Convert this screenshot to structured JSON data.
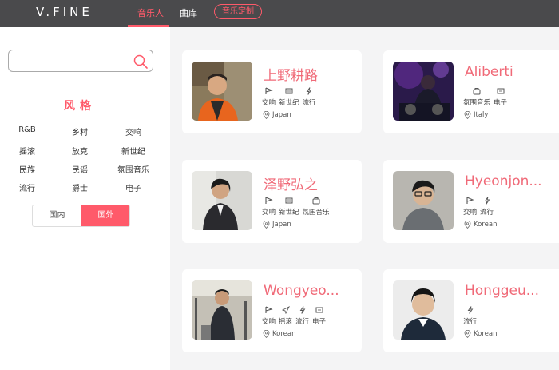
{
  "header": {
    "logo": "V.FINE",
    "nav": [
      {
        "label": "音乐人",
        "active": true
      },
      {
        "label": "曲库",
        "active": false
      },
      {
        "label": "音乐定制",
        "active": false
      }
    ]
  },
  "sidebar": {
    "search": {
      "value": "",
      "placeholder": ""
    },
    "style_title": "风格",
    "genres": [
      "R&B",
      "乡村",
      "交响",
      "摇滚",
      "放克",
      "新世纪",
      "民族",
      "民谣",
      "氛围音乐",
      "流行",
      "爵士",
      "电子"
    ],
    "region": {
      "domestic": "国内",
      "foreign": "国外",
      "selected": "国外"
    }
  },
  "artists": [
    {
      "name": "上野耕路",
      "tags": [
        {
          "icon": "symphony-icon",
          "label": "交响"
        },
        {
          "icon": "new-age-icon",
          "label": "新世纪"
        },
        {
          "icon": "pop-icon",
          "label": "流行"
        }
      ],
      "location": "Japan"
    },
    {
      "name": "Aliberti",
      "tags": [
        {
          "icon": "ambient-icon",
          "label": "氛围音乐"
        },
        {
          "icon": "electronic-icon",
          "label": "电子"
        }
      ],
      "location": "Italy"
    },
    {
      "name": "泽野弘之",
      "tags": [
        {
          "icon": "symphony-icon",
          "label": "交响"
        },
        {
          "icon": "new-age-icon",
          "label": "新世纪"
        },
        {
          "icon": "ambient-icon",
          "label": "氛围音乐"
        }
      ],
      "location": "Japan"
    },
    {
      "name": "Hyeonjon...",
      "tags": [
        {
          "icon": "symphony-icon",
          "label": "交响"
        },
        {
          "icon": "pop-icon",
          "label": "流行"
        }
      ],
      "location": "Korean"
    },
    {
      "name": "Wongyeo...",
      "tags": [
        {
          "icon": "symphony-icon",
          "label": "交响"
        },
        {
          "icon": "rock-icon",
          "label": "摇滚"
        },
        {
          "icon": "pop-icon",
          "label": "流行"
        },
        {
          "icon": "electronic-icon",
          "label": "电子"
        }
      ],
      "location": "Korean"
    },
    {
      "name": "Honggeu...",
      "tags": [
        {
          "icon": "pop-icon",
          "label": "流行"
        }
      ],
      "location": "Korean"
    }
  ],
  "colors": {
    "accent": "#ff5a6a",
    "header_bg": "#4a4a4c",
    "name": "#f06a78"
  }
}
